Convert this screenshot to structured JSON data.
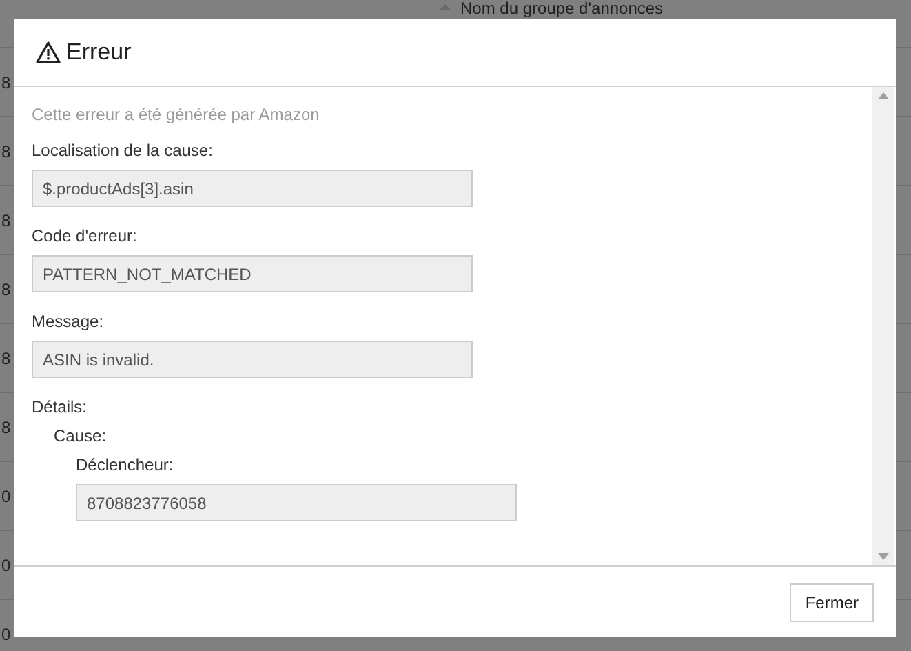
{
  "background": {
    "column_header": "Nom du groupe d'annonces",
    "row_fragments": [
      "8",
      "8",
      "8",
      "8",
      "8",
      "8",
      "0",
      "0",
      "0"
    ]
  },
  "dialog": {
    "title": "Erreur",
    "subtitle": "Cette erreur a été générée par Amazon",
    "fields": [
      {
        "label": "Localisation de la cause:",
        "value": "$.productAds[3].asin"
      },
      {
        "label": "Code d'erreur:",
        "value": "PATTERN_NOT_MATCHED"
      },
      {
        "label": "Message:",
        "value": "ASIN is invalid."
      },
      {
        "label": "Détails:",
        "children": [
          {
            "label": "Cause:",
            "children": [
              {
                "label": "Déclencheur:",
                "value": "8708823776058"
              }
            ]
          }
        ]
      }
    ],
    "buttons": [
      "Fermer"
    ]
  }
}
